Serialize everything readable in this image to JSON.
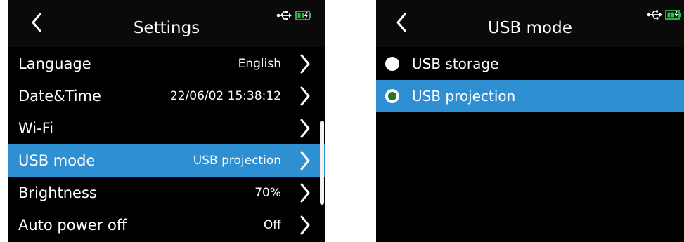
{
  "colors": {
    "background": "#000000",
    "selection": "#2e8fd3",
    "radio_checked": "#1f7a24",
    "battery": "#2bbf4a"
  },
  "settings_screen": {
    "title": "Settings",
    "back_icon": "chevron-left-icon",
    "status_icons": [
      "usb-icon",
      "battery-charging-icon"
    ],
    "rows": [
      {
        "label": "Language",
        "value": "English",
        "selected": false
      },
      {
        "label": "Date&Time",
        "value": "22/06/02 15:38:12",
        "selected": false
      },
      {
        "label": "Wi-Fi",
        "value": "",
        "selected": false
      },
      {
        "label": "USB mode",
        "value": "USB projection",
        "selected": true
      },
      {
        "label": "Brightness",
        "value": "70%",
        "selected": false
      },
      {
        "label": "Auto power off",
        "value": "Off",
        "selected": false
      }
    ]
  },
  "usb_mode_screen": {
    "title": "USB mode",
    "back_icon": "chevron-left-icon",
    "status_icons": [
      "usb-icon",
      "battery-charging-icon"
    ],
    "options": [
      {
        "label": "USB storage",
        "checked": false,
        "selected": false
      },
      {
        "label": "USB projection",
        "checked": true,
        "selected": true
      }
    ]
  }
}
